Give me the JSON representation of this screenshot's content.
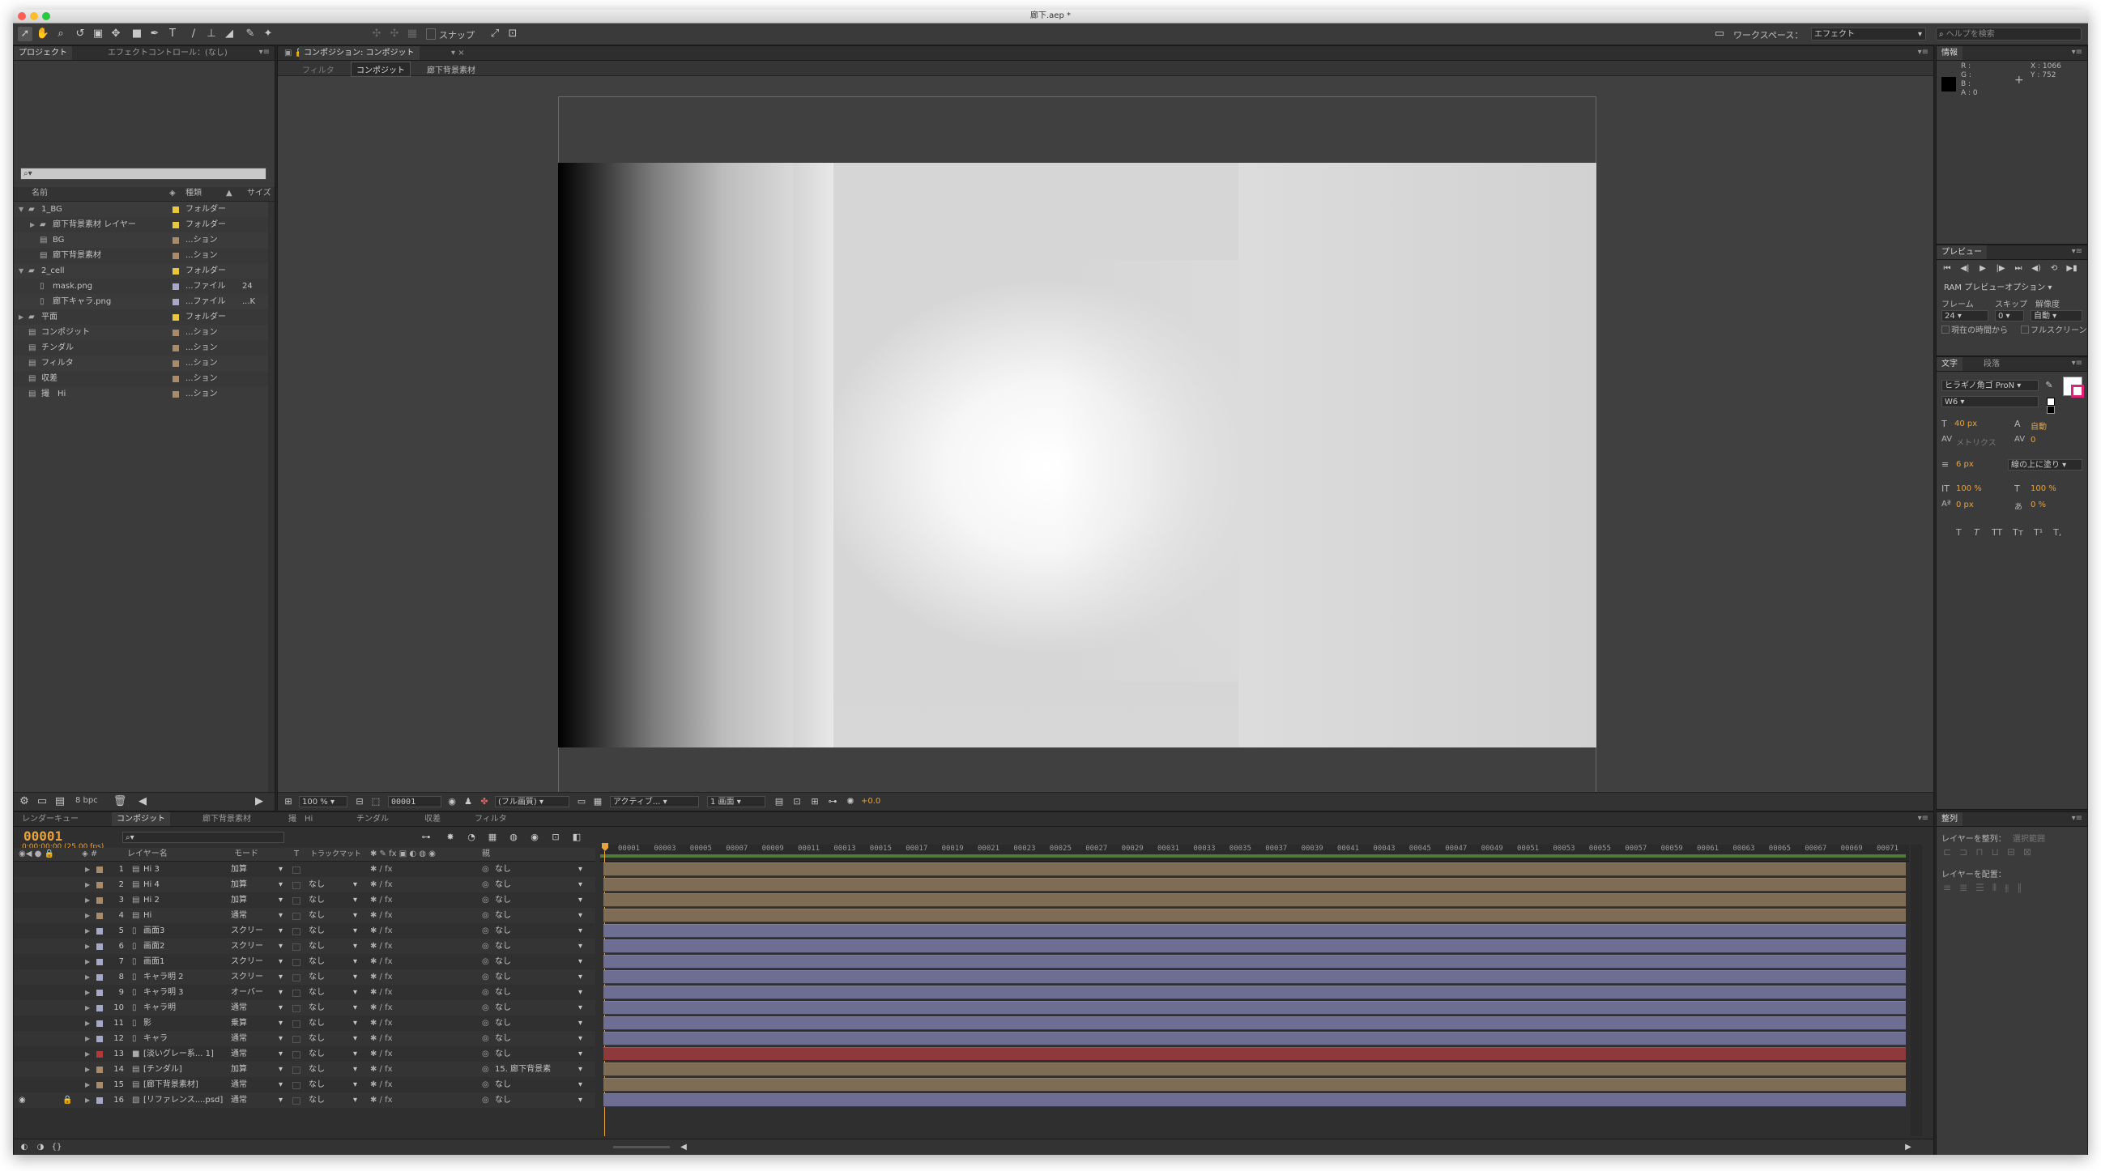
{
  "window": {
    "title": "廊下.aep *"
  },
  "toolbar": {
    "snap_label": "スナップ",
    "workspace_label": "ワークスペース：",
    "workspace_value": "エフェクト",
    "help_placeholder": "ヘルプを検索"
  },
  "project": {
    "tab_project": "プロジェクト",
    "tab_effects": "エフェクトコントロール：(なし)",
    "search_placeholder": "⌕▾",
    "columns": {
      "name": "名前",
      "type": "種類",
      "size": "サイズ"
    },
    "items": [
      {
        "name": "1_BG",
        "type": "フォルダー",
        "size": "",
        "color": "#e8c740",
        "icon": "folder",
        "indent": 0,
        "twirl": "▼"
      },
      {
        "name": "廊下背景素材 レイヤー",
        "type": "フォルダー",
        "size": "",
        "color": "#e8c740",
        "icon": "folder",
        "indent": 1,
        "twirl": "▶"
      },
      {
        "name": "BG",
        "type": "...ション",
        "size": "",
        "color": "#a88b6a",
        "icon": "comp",
        "indent": 1,
        "twirl": ""
      },
      {
        "name": "廊下背景素材",
        "type": "...ション",
        "size": "",
        "color": "#a88b6a",
        "icon": "comp",
        "indent": 1,
        "twirl": ""
      },
      {
        "name": "2_cell",
        "type": "フォルダー",
        "size": "",
        "color": "#e8c740",
        "icon": "folder",
        "indent": 0,
        "twirl": "▼"
      },
      {
        "name": "mask.png",
        "type": "...ファイル",
        "size": "24",
        "color": "#a7a7c8",
        "icon": "file",
        "indent": 1,
        "twirl": ""
      },
      {
        "name": "廊下キャラ.png",
        "type": "...ファイル",
        "size": "...K",
        "color": "#a7a7c8",
        "icon": "file",
        "indent": 1,
        "twirl": ""
      },
      {
        "name": "平面",
        "type": "フォルダー",
        "size": "",
        "color": "#e8c740",
        "icon": "folder",
        "indent": 0,
        "twirl": "▶"
      },
      {
        "name": "コンポジット",
        "type": "...ション",
        "size": "",
        "color": "#a88b6a",
        "icon": "comp",
        "indent": 0,
        "twirl": ""
      },
      {
        "name": "チンダル",
        "type": "...ション",
        "size": "",
        "color": "#a88b6a",
        "icon": "comp",
        "indent": 0,
        "twirl": ""
      },
      {
        "name": "フィルタ",
        "type": "...ション",
        "size": "",
        "color": "#a88b6a",
        "icon": "comp",
        "indent": 0,
        "twirl": ""
      },
      {
        "name": "収差",
        "type": "...ション",
        "size": "",
        "color": "#a88b6a",
        "icon": "comp",
        "indent": 0,
        "twirl": ""
      },
      {
        "name": "撮　Hi",
        "type": "...ション",
        "size": "",
        "color": "#a88b6a",
        "icon": "comp",
        "indent": 0,
        "twirl": ""
      }
    ],
    "bpc_label": "8 bpc"
  },
  "viewer": {
    "tab_label": "コンポジション: コンポジット",
    "crumbs": [
      "フィルタ",
      "コンポジット",
      "廊下背景素材"
    ],
    "zoom": "100 %",
    "frame": "00001",
    "resolution": "(フル画質)",
    "camera": "アクティブ...",
    "views": "1 画面",
    "exposure": "+0.0"
  },
  "info": {
    "tab": "情報",
    "r": "R :",
    "g": "G :",
    "b": "B :",
    "a": "A : 0",
    "x": "X : 1066",
    "y": "Y : 752"
  },
  "preview": {
    "tab": "プレビュー",
    "ram_label": "RAM プレビューオプション",
    "frame_label": "フレーム",
    "skip_label": "スキップ",
    "res_label": "解像度",
    "fps_value": "24",
    "skip_value": "0",
    "res_value": "自動",
    "from_current": "現在の時間から",
    "fullscreen": "フルスクリーン"
  },
  "character": {
    "tab": "文字",
    "tab2": "段落",
    "font": "ヒラギノ角ゴ ProN",
    "style": "W6",
    "size": "40 px",
    "leading": "自動",
    "kerning": "メトリクス",
    "tracking": "0",
    "stroke": "6 px",
    "stroke_mode": "線の上に塗り",
    "vscale": "100 %",
    "hscale": "100 %",
    "baseline": "0 px",
    "tsume": "0 %",
    "styles": [
      "T",
      "T",
      "TT",
      "Tт",
      "T¹",
      "T,"
    ]
  },
  "align": {
    "tab": "整列",
    "align_to_label": "レイヤーを整列：",
    "align_to_value": "選択範囲",
    "distribute_label": "レイヤーを配置："
  },
  "timeline": {
    "tabs": [
      "レンダーキュー",
      "コンポジット",
      "廊下背景素材",
      "撮　Hi",
      "チンダル",
      "収差",
      "フィルタ"
    ],
    "active_tab": 1,
    "timecode": "00001",
    "timecode_sub": "0:00:00:00 (25.00 fps)",
    "search_placeholder": "⌕▾",
    "col_name": "レイヤー名",
    "col_mode": "モード",
    "col_t": "T",
    "col_trkmat": "トラックマット",
    "col_parent": "親",
    "ruler": [
      "00001",
      "00003",
      "00005",
      "00007",
      "00009",
      "00011",
      "00013",
      "00015",
      "00017",
      "00019",
      "00021",
      "00023",
      "00025",
      "00027",
      "00029",
      "00031",
      "00033",
      "00035",
      "00037",
      "00039",
      "00041",
      "00043",
      "00045",
      "00047",
      "00049",
      "00051",
      "00053",
      "00055",
      "00057",
      "00059",
      "00061",
      "00063",
      "00065",
      "00067",
      "00069",
      "00071"
    ],
    "layers": [
      {
        "num": "1",
        "name": "Hi 3",
        "mode": "加算",
        "trk": "",
        "parent": "なし",
        "color": "#a88b6a",
        "icon": "comp",
        "bar": "#7e6c55"
      },
      {
        "num": "2",
        "name": "Hi 4",
        "mode": "加算",
        "trk": "なし",
        "parent": "なし",
        "color": "#a88b6a",
        "icon": "comp",
        "bar": "#7e6c55"
      },
      {
        "num": "3",
        "name": "Hi 2",
        "mode": "加算",
        "trk": "なし",
        "parent": "なし",
        "color": "#a88b6a",
        "icon": "comp",
        "bar": "#7e6c55"
      },
      {
        "num": "4",
        "name": "Hi",
        "mode": "通常",
        "trk": "なし",
        "parent": "なし",
        "color": "#a88b6a",
        "icon": "comp",
        "bar": "#7e6c55"
      },
      {
        "num": "5",
        "name": "画面3",
        "mode": "スクリー",
        "trk": "なし",
        "parent": "なし",
        "color": "#a7a7c8",
        "icon": "file",
        "bar": "#6e6d92"
      },
      {
        "num": "6",
        "name": "画面2",
        "mode": "スクリー",
        "trk": "なし",
        "parent": "なし",
        "color": "#a7a7c8",
        "icon": "file",
        "bar": "#6e6d92"
      },
      {
        "num": "7",
        "name": "画面1",
        "mode": "スクリー",
        "trk": "なし",
        "parent": "なし",
        "color": "#a7a7c8",
        "icon": "file",
        "bar": "#6e6d92"
      },
      {
        "num": "8",
        "name": "キャラ明 2",
        "mode": "スクリー",
        "trk": "なし",
        "parent": "なし",
        "color": "#a7a7c8",
        "icon": "file",
        "bar": "#6e6d92"
      },
      {
        "num": "9",
        "name": "キャラ明 3",
        "mode": "オーバー",
        "trk": "なし",
        "parent": "なし",
        "color": "#a7a7c8",
        "icon": "file",
        "bar": "#6e6d92"
      },
      {
        "num": "10",
        "name": "キャラ明",
        "mode": "通常",
        "trk": "なし",
        "parent": "なし",
        "color": "#a7a7c8",
        "icon": "file",
        "bar": "#6e6d92"
      },
      {
        "num": "11",
        "name": "影",
        "mode": "乗算",
        "trk": "なし",
        "parent": "なし",
        "color": "#a7a7c8",
        "icon": "file",
        "bar": "#6e6d92"
      },
      {
        "num": "12",
        "name": "キャラ",
        "mode": "通常",
        "trk": "なし",
        "parent": "なし",
        "color": "#a7a7c8",
        "icon": "file",
        "bar": "#6e6d92"
      },
      {
        "num": "13",
        "name": "[淡いグレー系... 1]",
        "mode": "通常",
        "trk": "なし",
        "parent": "なし",
        "color": "#b03a3a",
        "icon": "solid",
        "bar": "#8e3a3a"
      },
      {
        "num": "14",
        "name": "[チンダル]",
        "mode": "加算",
        "trk": "なし",
        "parent": "15. 廊下背景素",
        "color": "#a88b6a",
        "icon": "comp",
        "bar": "#7e6c55"
      },
      {
        "num": "15",
        "name": "[廊下背景素材]",
        "mode": "通常",
        "trk": "なし",
        "parent": "なし",
        "color": "#a88b6a",
        "icon": "comp",
        "bar": "#7e6c55"
      },
      {
        "num": "16",
        "name": "[リファレンス....psd]",
        "mode": "通常",
        "trk": "なし",
        "parent": "なし",
        "color": "#a7a7c8",
        "icon": "psd",
        "bar": "#6e6d92"
      }
    ]
  },
  "colors": {
    "accent": "#e8a23b",
    "panel": "#3b3b3b",
    "dark": "#232323"
  }
}
